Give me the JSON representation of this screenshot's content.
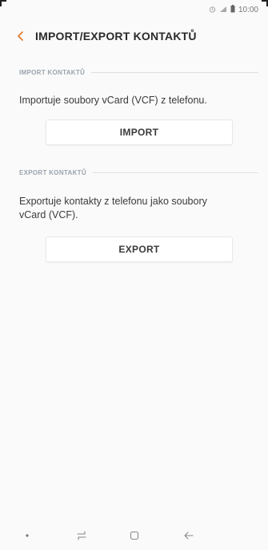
{
  "status_bar": {
    "time": "10:00",
    "icons": [
      "alarm-icon",
      "signal-icon",
      "battery-icon"
    ]
  },
  "app_bar": {
    "title": "IMPORT/EXPORT KONTAKTŮ"
  },
  "import_section": {
    "header": "IMPORT KONTAKTŮ",
    "description": "Importuje soubory vCard (VCF) z telefonu.",
    "button_label": "IMPORT"
  },
  "export_section": {
    "header": "EXPORT KONTAKTŮ",
    "description": "Exportuje kontakty z telefonu jako soubory vCard (VCF).",
    "button_label": "EXPORT"
  },
  "nav_bar": {
    "items": [
      "dot-icon",
      "recent-apps-icon",
      "home-icon",
      "back-arrow-icon"
    ]
  },
  "colors": {
    "background": "#fafafa",
    "section_header": "#9aa4ad",
    "button_bg": "#ffffff"
  }
}
